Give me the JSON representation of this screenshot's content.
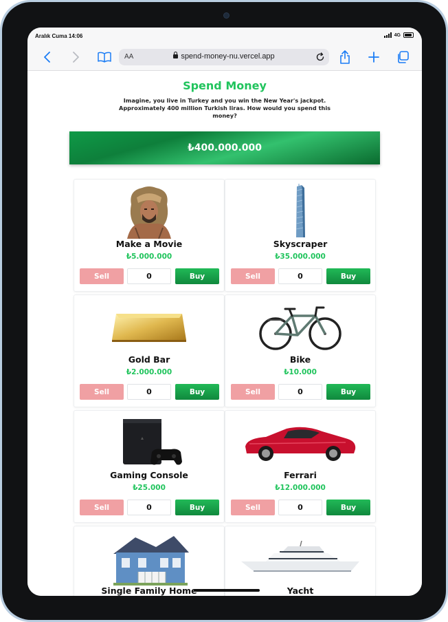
{
  "status_bar": {
    "time": "Aralık Cuma 14:06",
    "network": "4G"
  },
  "browser": {
    "text_size_label": "AA",
    "url": "spend-money-nu.vercel.app"
  },
  "page": {
    "title": "Spend Money",
    "subtitle": "Imagine, you live in Turkey and you win the New Year's jackpot. Approximately 400 million Turkish liras. How would you spend this money?",
    "balance": "₺400.000.000"
  },
  "items": [
    {
      "name": "Make a Movie",
      "price": "₺5.000.000",
      "quantity": "0",
      "sell_label": "Sell",
      "buy_label": "Buy",
      "icon": "lion-headdress-actor-image"
    },
    {
      "name": "Skyscraper",
      "price": "₺35.000.000",
      "quantity": "0",
      "sell_label": "Sell",
      "buy_label": "Buy",
      "icon": "skyscraper-image"
    },
    {
      "name": "Gold Bar",
      "price": "₺2.000.000",
      "quantity": "0",
      "sell_label": "Sell",
      "buy_label": "Buy",
      "icon": "gold-bar-image"
    },
    {
      "name": "Bike",
      "price": "₺10.000",
      "quantity": "0",
      "sell_label": "Sell",
      "buy_label": "Buy",
      "icon": "bike-image"
    },
    {
      "name": "Gaming Console",
      "price": "₺25.000",
      "quantity": "0",
      "sell_label": "Sell",
      "buy_label": "Buy",
      "icon": "gaming-console-image"
    },
    {
      "name": "Ferrari",
      "price": "₺12.000.000",
      "quantity": "0",
      "sell_label": "Sell",
      "buy_label": "Buy",
      "icon": "ferrari-image"
    },
    {
      "name": "Single Family Home",
      "icon": "house-image"
    },
    {
      "name": "Yacht",
      "icon": "yacht-image"
    }
  ],
  "colors": {
    "accent": "#21c45d",
    "sell": "#f0a0a3",
    "buy": "#10893d"
  }
}
